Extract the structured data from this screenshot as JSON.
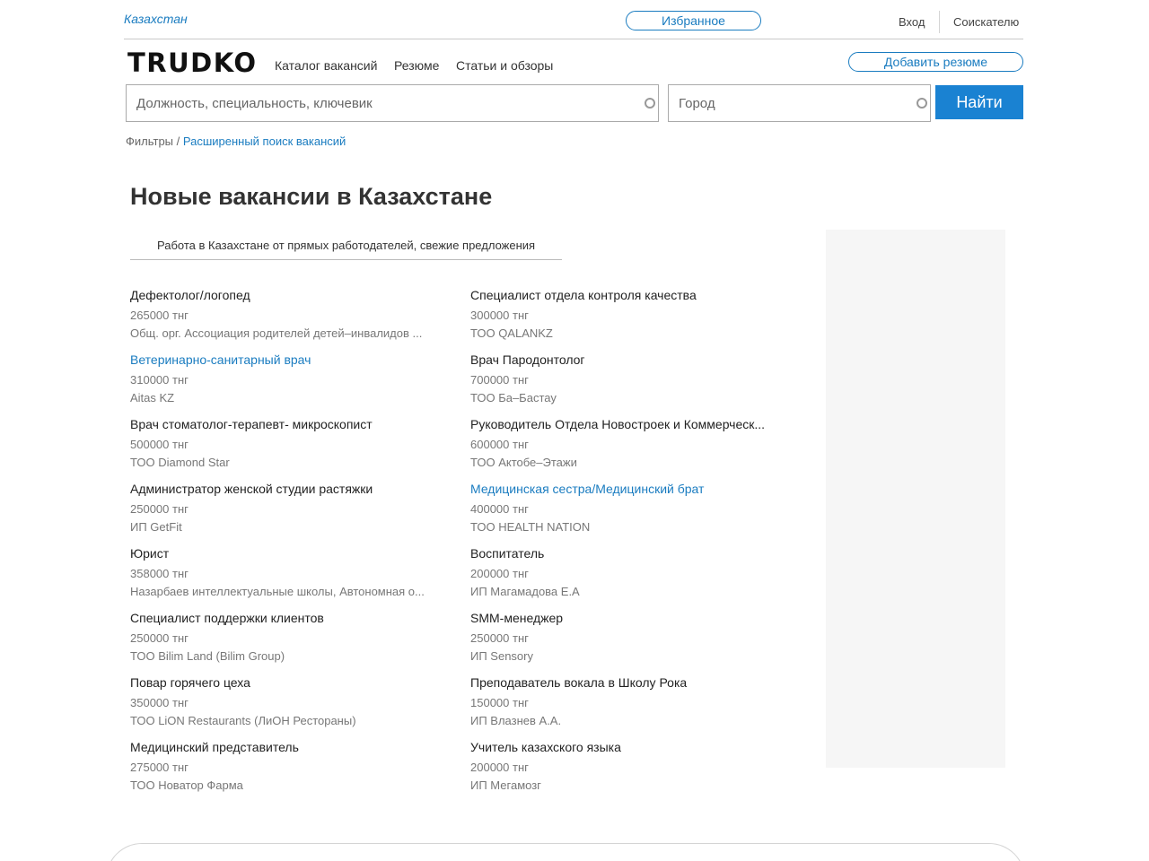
{
  "topbar": {
    "region": "Казахстан",
    "favorites": "Избранное",
    "login": "Вход",
    "seeker": "Соискателю"
  },
  "header": {
    "logo": "TRUDKO",
    "nav": [
      "Каталог вакансий",
      "Резюме",
      "Статьи и обзоры"
    ],
    "add_resume": "Добавить резюме"
  },
  "search": {
    "query_placeholder": "Должность, специальность, ключевик",
    "city_placeholder": "Город",
    "button": "Найти"
  },
  "breadcrumb": {
    "filters": "Фильтры",
    "separator": " / ",
    "advanced": "Расширенный поиск вакансий"
  },
  "page": {
    "title": "Новые вакансии в Казахстане",
    "subtitle": "Работа в Казахстане от прямых работодателей, свежие предложения"
  },
  "colors": {
    "accent": "#1a82d2",
    "link": "#1a7cc0",
    "muted": "#777777"
  },
  "jobs": [
    {
      "title": "Дефектолог/логопед",
      "salary": "265000 тнг",
      "company": "Общ. орг. Ассоциация родителей детей–инвалидов ...",
      "visited": false
    },
    {
      "title": "Специалист отдела контроля качества",
      "salary": "300000 тнг",
      "company": "ТОО QALANKZ",
      "visited": false
    },
    {
      "title": "Ветеринарно-санитарный врач",
      "salary": "310000 тнг",
      "company": "Aitas KZ",
      "visited": true
    },
    {
      "title": "Врач Пародонтолог",
      "salary": "700000 тнг",
      "company": "ТОО Ба–Бастау",
      "visited": false
    },
    {
      "title": "Врач стоматолог-терапевт- микроскопист",
      "salary": "500000 тнг",
      "company": "ТОО Diamond Star",
      "visited": false
    },
    {
      "title": "Руководитель Отдела Новостроек и Коммерческ...",
      "salary": "600000 тнг",
      "company": "ТОО Актобе–Этажи",
      "visited": false
    },
    {
      "title": "Администратор женской студии растяжки",
      "salary": "250000 тнг",
      "company": "ИП GetFit",
      "visited": false
    },
    {
      "title": "Медицинская сестра/Медицинский брат",
      "salary": "400000 тнг",
      "company": "ТОО HEALTH NATION",
      "visited": true
    },
    {
      "title": "Юрист",
      "salary": "358000 тнг",
      "company": "Назарбаев интеллектуальные школы, Автономная о...",
      "visited": false
    },
    {
      "title": "Воспитатель",
      "salary": "200000 тнг",
      "company": "ИП Магамадова Е.А",
      "visited": false
    },
    {
      "title": "Специалист поддержки клиентов",
      "salary": "250000 тнг",
      "company": "ТОО Bilim Land (Bilim Group)",
      "visited": false
    },
    {
      "title": "SMM-менеджер",
      "salary": "250000 тнг",
      "company": "ИП Sensory",
      "visited": false
    },
    {
      "title": "Повар горячего цеха",
      "salary": "350000 тнг",
      "company": "ТОО LiON Restaurants (ЛиОН Рестораны)",
      "visited": false
    },
    {
      "title": "Преподаватель вокала в Школу Рока",
      "salary": "150000 тнг",
      "company": "ИП Влазнев А.А.",
      "visited": false
    },
    {
      "title": "Медицинский представитель",
      "salary": "275000 тнг",
      "company": "ТОО Новатор Фарма",
      "visited": false
    },
    {
      "title": "Учитель казахского языка",
      "salary": "200000 тнг",
      "company": "ИП Мегамозг",
      "visited": false
    }
  ]
}
